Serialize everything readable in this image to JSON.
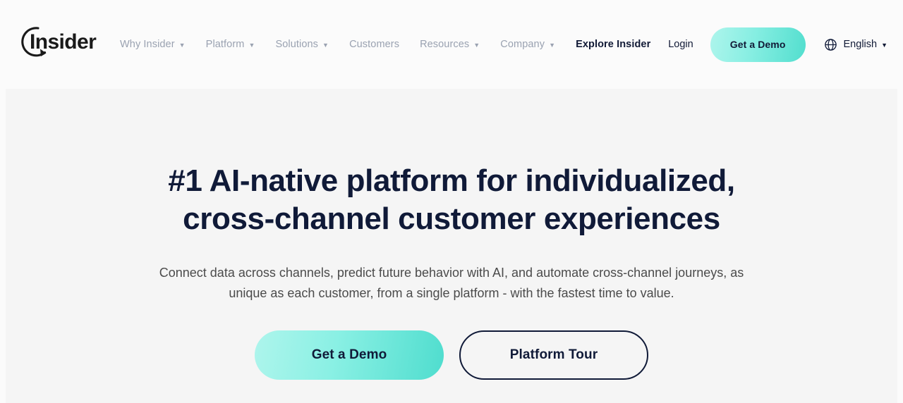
{
  "brand": {
    "logo_text": "Insider",
    "logo_icon": "circular-arrow-icon"
  },
  "colors": {
    "header_bg": "#FBFBFB",
    "hero_bg": "#F5F5F5",
    "navy": "#101A38",
    "nav_muted": "#9AA2B1",
    "body_text": "#4B4B4B",
    "accent_gradient_start": "#AEF5EC",
    "accent_gradient_end": "#4FDDCE"
  },
  "header": {
    "nav_items": [
      {
        "label": "Why Insider",
        "has_caret": true,
        "highlight": false
      },
      {
        "label": "Platform",
        "has_caret": true,
        "highlight": false
      },
      {
        "label": "Solutions",
        "has_caret": true,
        "highlight": false
      },
      {
        "label": "Customers",
        "has_caret": false,
        "highlight": false
      },
      {
        "label": "Resources",
        "has_caret": true,
        "highlight": false
      },
      {
        "label": "Company",
        "has_caret": true,
        "highlight": false
      },
      {
        "label": "Explore Insider",
        "has_caret": false,
        "highlight": true
      }
    ],
    "caret_glyph": "▼",
    "login_label": "Login",
    "demo_label": "Get a Demo",
    "language": {
      "icon": "globe-icon",
      "label": "English",
      "caret": "▼"
    }
  },
  "hero": {
    "title_line1": "#1 AI-native platform for individualized,",
    "title_line2": "cross-channel customer experiences",
    "subtitle_line1": "Connect data across channels, predict future behavior with AI, and automate cross-channel",
    "subtitle_line2": "journeys, as unique as each customer, from a single platform - with the fastest time to value.",
    "primary_cta": "Get a Demo",
    "secondary_cta": "Platform Tour"
  }
}
